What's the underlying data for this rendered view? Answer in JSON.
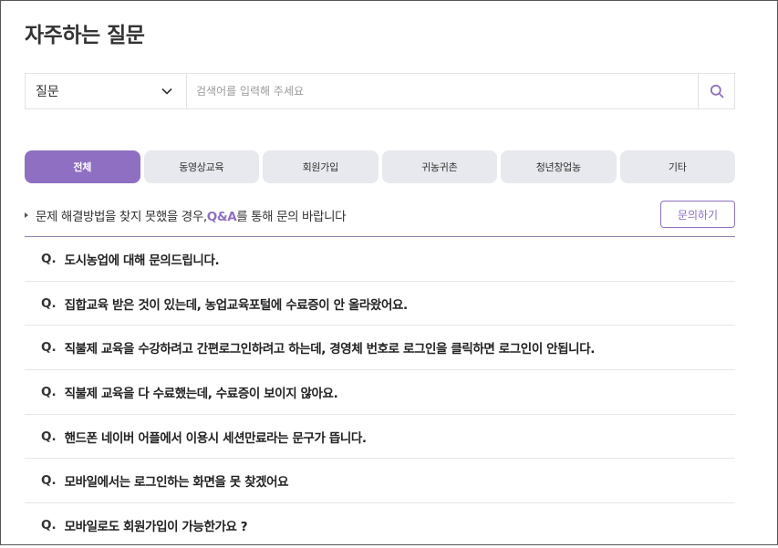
{
  "page": {
    "title": "자주하는 질문"
  },
  "search": {
    "category_selected": "질문",
    "placeholder": "검색어를 입력해 주세요",
    "value": ""
  },
  "tabs": [
    {
      "label": "전체",
      "active": true
    },
    {
      "label": "동영상교육",
      "active": false
    },
    {
      "label": "회원가입",
      "active": false
    },
    {
      "label": "귀농귀촌",
      "active": false
    },
    {
      "label": "청년창업농",
      "active": false
    },
    {
      "label": "기타",
      "active": false
    }
  ],
  "notice": {
    "prefix": "문제 해결방법을 찾지 못했을 경우,",
    "highlight": "Q&A",
    "suffix": "를 통해 문의 바랍니다",
    "button_label": "문의하기"
  },
  "faq": {
    "marker": "Q.",
    "items": [
      "도시농업에 대해 문의드립니다.",
      "집합교육 받은 것이 있는데, 농업교육포털에 수료증이 안 올라왔어요.",
      "직불제 교육을 수강하려고 간편로그인하려고 하는데, 경영체 번호로 로그인을 클릭하면 로그인이 안됩니다.",
      "직불제 교육을 다 수료했는데, 수료증이 보이지 않아요.",
      "핸드폰 네이버 어플에서 이용시 세션만료라는 문구가 뜹니다.",
      "모바일에서는 로그인하는 화면을 못 찾겠어요",
      "모바일로도 회원가입이 가능한가요 ?"
    ]
  },
  "colors": {
    "accent": "#8f6fc1",
    "tab_bg": "#e7e9ee"
  },
  "icons": {
    "search": "search-icon",
    "dropdown": "chevron-down-icon",
    "bullet": "triangle-right-icon"
  }
}
